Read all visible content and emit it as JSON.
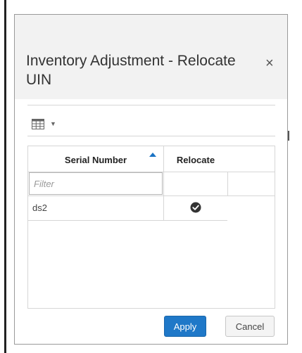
{
  "dialog": {
    "title": "Inventory Adjustment - Relocate UIN",
    "close_glyph": "×"
  },
  "toolbar": {
    "view_icon": "table-grid-icon",
    "dropdown_icon": "caret-down-icon"
  },
  "table": {
    "columns": [
      {
        "label": "Serial Number",
        "sort": "ascending"
      },
      {
        "label": "Relocate"
      }
    ],
    "filter_placeholder": "Filter",
    "rows": [
      {
        "serial_number": "ds2",
        "relocate": true
      }
    ]
  },
  "footer": {
    "apply_label": "Apply",
    "cancel_label": "Cancel"
  },
  "colors": {
    "primary": "#1f78c8",
    "header_bg": "#f2f2f2",
    "border": "#d6d6d6"
  }
}
